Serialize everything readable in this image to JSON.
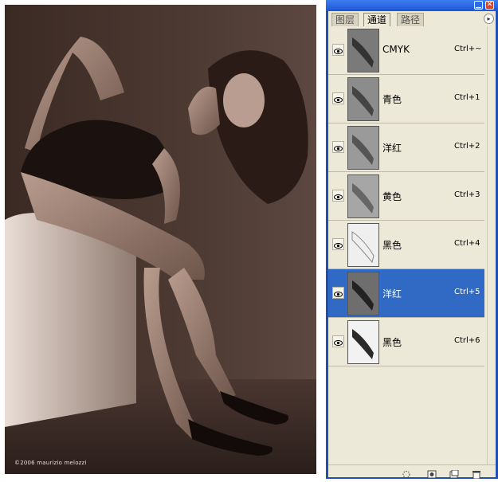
{
  "document": {
    "photo_caption": "©2006 maurizio melozzi"
  },
  "palette": {
    "tabs": [
      {
        "label": "图层",
        "active": false
      },
      {
        "label": "通道",
        "active": true
      },
      {
        "label": "路径",
        "active": false
      }
    ],
    "channels": [
      {
        "name": "CMYK",
        "shortcut": "Ctrl+~",
        "visible": true,
        "selected": false,
        "thumb_tone": "#7a7a7a"
      },
      {
        "name": "青色",
        "shortcut": "Ctrl+1",
        "visible": true,
        "selected": false,
        "thumb_tone": "#8c8c8c"
      },
      {
        "name": "洋红",
        "shortcut": "Ctrl+2",
        "visible": true,
        "selected": false,
        "thumb_tone": "#9a9a9a"
      },
      {
        "name": "黄色",
        "shortcut": "Ctrl+3",
        "visible": true,
        "selected": false,
        "thumb_tone": "#a6a6a6"
      },
      {
        "name": "黑色",
        "shortcut": "Ctrl+4",
        "visible": true,
        "selected": false,
        "thumb_tone": "#efefef"
      },
      {
        "name": "洋红",
        "shortcut": "Ctrl+5",
        "visible": true,
        "selected": true,
        "thumb_tone": "#6e6e6e"
      },
      {
        "name": "黑色",
        "shortcut": "Ctrl+6",
        "visible": true,
        "selected": false,
        "thumb_tone": "#2a2a2a"
      }
    ],
    "footer_icons": [
      "load-selection-icon",
      "save-selection-icon",
      "new-channel-icon",
      "delete-channel-icon"
    ],
    "colors": {
      "selected_row": "#316ac5",
      "panel_bg": "#ece9d8",
      "title_bar": "#1d56d4"
    }
  }
}
